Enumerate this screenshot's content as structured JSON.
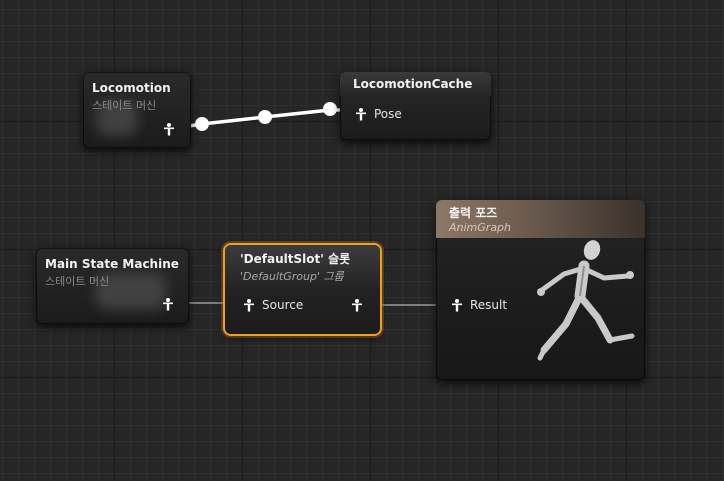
{
  "nodes": {
    "locomotion": {
      "title": "Locomotion",
      "subtitle": "스테이트 머신"
    },
    "locomotion_cache": {
      "title": "LocomotionCache",
      "pin_label": "Pose"
    },
    "main_state_machine": {
      "title": "Main State Machine",
      "subtitle": "스테이트 머신"
    },
    "default_slot": {
      "title": "'DefaultSlot' 슬롯",
      "subtitle": "'DefaultGroup' 그룹",
      "pin_label": "Source"
    },
    "output_pose": {
      "title": "출력 포즈",
      "subtitle": "AnimGraph",
      "pin_label": "Result"
    }
  },
  "colors": {
    "selection": "#f0a020",
    "wire": "#ffffff",
    "wire_dim": "#9a9a9a",
    "output_header": "#8c7866"
  },
  "icons": [
    "pose-pin-icon",
    "running-mannequin-icon"
  ]
}
